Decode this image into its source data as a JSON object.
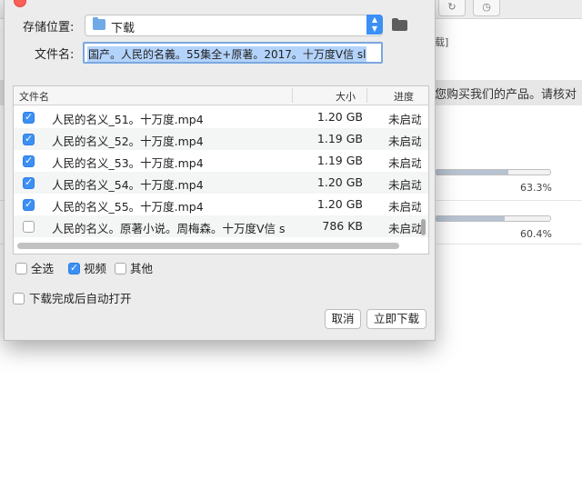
{
  "background": {
    "notice": "您购买我们的产品。请核对",
    "fragment_top": "载]",
    "items": [
      {
        "progress_percent": 63.3,
        "label": "63.3%"
      },
      {
        "progress_percent": 60.4,
        "label": "60.4%"
      }
    ]
  },
  "dialog": {
    "save_location_label": "存储位置:",
    "save_location_value": "下载",
    "filename_label": "文件名:",
    "filename_value": "国产。人民的名義。55集全+原著。2017。十万度V信 sl",
    "table": {
      "headers": [
        "文件名",
        "大小",
        "进度"
      ],
      "rows": [
        {
          "checked": true,
          "name": "人民的名义_51。十万度.mp4",
          "size": "1.20 GB",
          "progress": "未启动"
        },
        {
          "checked": true,
          "name": "人民的名义_52。十万度.mp4",
          "size": "1.19 GB",
          "progress": "未启动"
        },
        {
          "checked": true,
          "name": "人民的名义_53。十万度.mp4",
          "size": "1.19 GB",
          "progress": "未启动"
        },
        {
          "checked": true,
          "name": "人民的名义_54。十万度.mp4",
          "size": "1.20 GB",
          "progress": "未启动"
        },
        {
          "checked": true,
          "name": "人民的名义_55。十万度.mp4",
          "size": "1.20 GB",
          "progress": "未启动"
        },
        {
          "checked": false,
          "name": "人民的名义。原著小说。周梅森。十万度V信 s",
          "size": "786 KB",
          "progress": "未启动"
        }
      ]
    },
    "filters": {
      "select_all": {
        "label": "全选",
        "checked": false
      },
      "video": {
        "label": "视频",
        "checked": true
      },
      "other": {
        "label": "其他",
        "checked": false
      }
    },
    "auto_open": {
      "label": "下载完成后自动打开",
      "checked": false
    },
    "cancel_label": "取消",
    "download_label": "立即下载"
  },
  "icons": {
    "folder": "folder-icon",
    "popup_arrows": "updown-arrows-icon",
    "browse": "open-folder-icon",
    "refresh": "refresh-icon",
    "history": "clock-icon",
    "close": "close-dot-icon"
  },
  "colors": {
    "accent": "#3b8ff5",
    "selection": "#b3d3fb",
    "close": "#fc5f57"
  }
}
